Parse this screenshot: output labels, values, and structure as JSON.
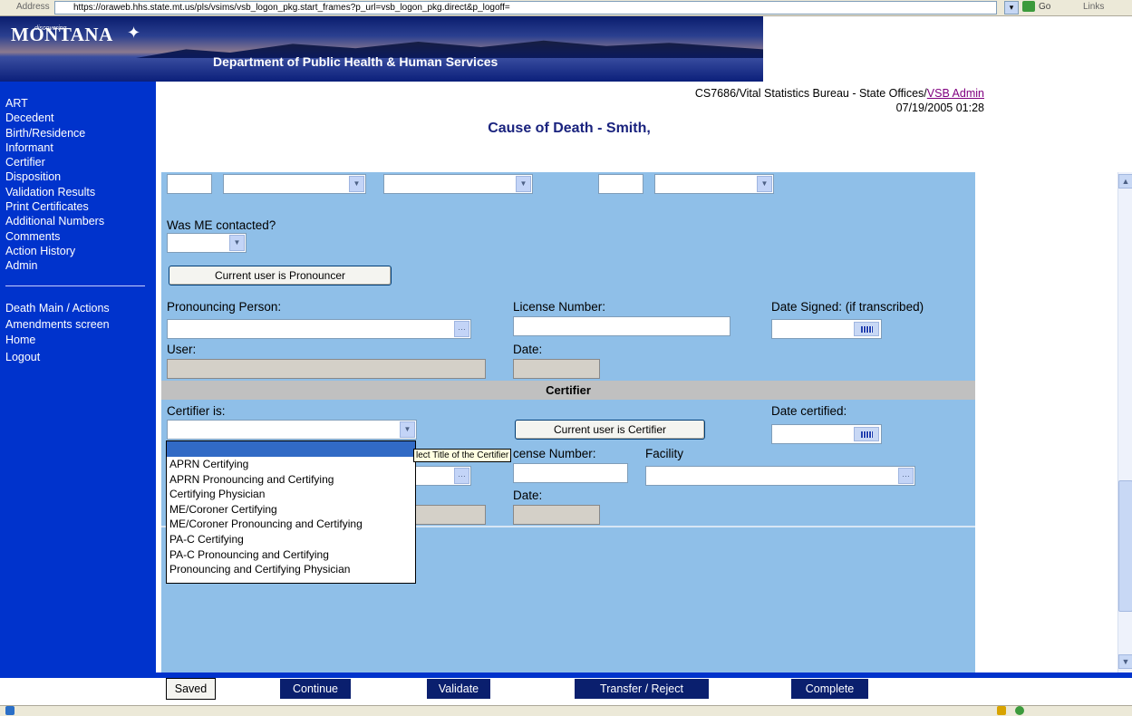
{
  "browser": {
    "address_label": "Address",
    "url": "https://oraweb.hhs.state.mt.us/pls/vsims/vsb_logon_pkg.start_frames?p_url=vsb_logon_pkg.direct&p_logoff=",
    "go_label": "Go",
    "links_label": "Links"
  },
  "banner": {
    "logo_small": "discovering",
    "logo": "MONTANA",
    "department": "Department of Public Health & Human Services"
  },
  "sidebar": {
    "items": [
      "ART",
      "Decedent",
      "Birth/Residence",
      "Informant",
      "Certifier",
      "Disposition",
      "Validation Results",
      "Print Certificates",
      "Additional Numbers",
      "Comments",
      "Action History",
      "Admin"
    ],
    "secondary": [
      "Death Main / Actions",
      "Amendments screen",
      "Home"
    ],
    "logout": "Logout"
  },
  "header": {
    "user_prefix": "CS7686/Vital Statistics Bureau - State Offices/",
    "user_link": "VSB Admin",
    "datetime": "07/19/2005 01:28",
    "title": "Cause of Death - Smith,"
  },
  "pronouncer": {
    "me_contacted_label": "Was ME contacted?",
    "current_user_button": "Current user is Pronouncer",
    "pronouncing_person_label": "Pronouncing Person:",
    "license_number_label": "License Number:",
    "date_signed_label": "Date Signed: (if transcribed)",
    "user_label": "User:",
    "date_label": "Date:"
  },
  "certifier": {
    "section_title": "Certifier",
    "certifier_is_label": "Certifier is:",
    "current_user_button": "Current user is Certifier",
    "date_certified_label": "Date certified:",
    "license_number_label": "cense Number:",
    "facility_label": "Facility",
    "date_label": "Date:",
    "tooltip": "lect Title of the Certifier",
    "options": [
      "",
      "APRN Certifying",
      "APRN Pronouncing and Certifying",
      "Certifying Physician",
      "ME/Coroner Certifying",
      "ME/Coroner Pronouncing and Certifying",
      "PA-C Certifying",
      "PA-C Pronouncing and Certifying",
      "Pronouncing and Certifying Physician"
    ]
  },
  "actions": {
    "saved": "Saved",
    "continue": "Continue",
    "validate": "Validate",
    "transfer": "Transfer / Reject",
    "complete": "Complete"
  },
  "colors": {
    "sidebar": "#0033cc",
    "panel": "#8fbfe8",
    "action_button": "#0a1f6e",
    "link": "#800080"
  }
}
